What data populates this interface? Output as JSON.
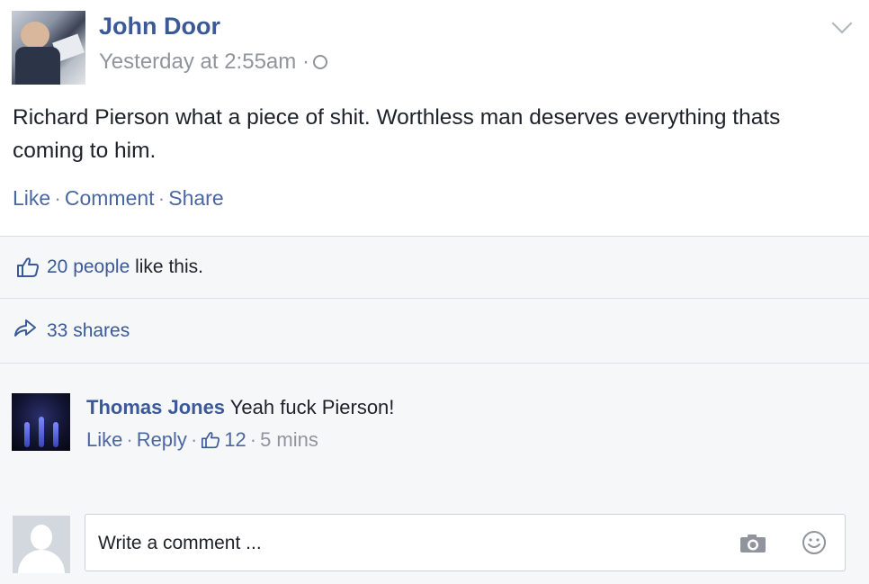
{
  "post": {
    "author": "John Door",
    "timestamp": "Yesterday at 2:55am",
    "timestamp_separator": "·",
    "text": "Richard Pierson what a piece of shit. Worthless man deserves everything thats coming to him.",
    "actions": {
      "like": "Like",
      "comment": "Comment",
      "share": "Share",
      "separator": "·"
    }
  },
  "feedback": {
    "likes_count": "20 people",
    "likes_suffix": " like this.",
    "shares": "33 shares"
  },
  "comments": [
    {
      "author": "Thomas Jones",
      "text": "Yeah fuck Pierson!",
      "like": "Like",
      "reply": "Reply",
      "like_count": "12",
      "time": "5 mins",
      "separator": "·"
    }
  ],
  "composer": {
    "placeholder": "Write a comment ..."
  },
  "icons": {
    "audience": "globe-icon",
    "menu": "chevron-down-icon",
    "likes": "thumbs-up-icon",
    "shares": "share-arrow-icon",
    "photo": "camera-icon",
    "emoji": "smiley-icon"
  },
  "colors": {
    "link": "#3b5998",
    "muted": "#90949c",
    "feedback_bg": "#f6f7f9"
  }
}
